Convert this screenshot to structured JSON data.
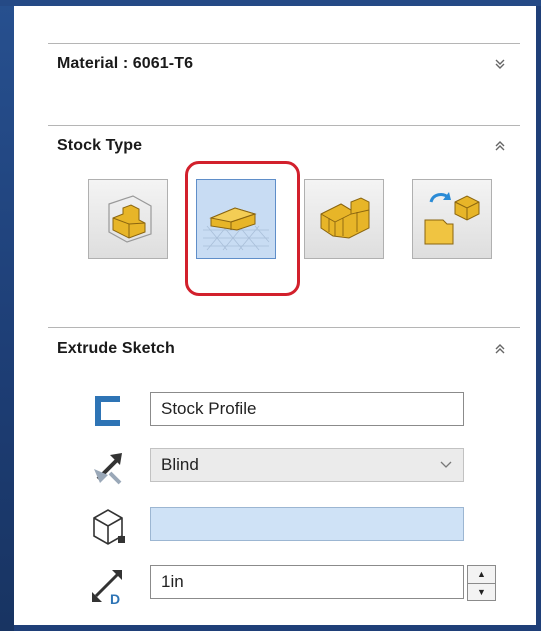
{
  "material": {
    "label": "Material : 6061-T6",
    "chevron_icon": "double-chevron-down-icon"
  },
  "stock_type": {
    "title": "Stock Type",
    "chevron_icon": "double-chevron-up-icon",
    "options": [
      {
        "icon": "bounding-box-stock-icon",
        "selected": false
      },
      {
        "icon": "extrude-sketch-stock-icon",
        "selected": true
      },
      {
        "icon": "cylinder-stock-icon",
        "selected": false
      },
      {
        "icon": "import-stock-icon",
        "selected": false
      }
    ]
  },
  "extrude_sketch": {
    "title": "Extrude Sketch",
    "chevron_icon": "double-chevron-up-icon",
    "profile_value": "Stock Profile",
    "end_condition": "Blind",
    "direction_value": "",
    "depth_value": "1in",
    "depth_icon_letter": "D"
  },
  "colors": {
    "highlight": "#d2202c",
    "selected_bg": "#c8dcf3",
    "gold": "#e7b528"
  }
}
